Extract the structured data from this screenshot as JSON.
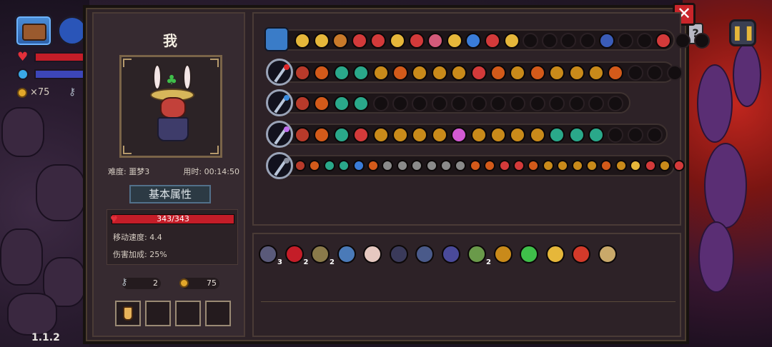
{
  "hud": {
    "coins": "×75",
    "version": "1.1.2",
    "pause_icon": "pause-icon",
    "help_icon": "?"
  },
  "panel": {
    "character_name": "我",
    "difficulty": "难度: 噩梦3",
    "time": "用时: 00:14:50",
    "stats_header": "基本属性",
    "hp": "343/343",
    "hp_fill": 1.0,
    "move_speed": "移动速度: 4.4",
    "damage_bonus": "伤害加成: 25%",
    "keys": "2",
    "coins": "75",
    "close_icon": "✕"
  },
  "colors": {
    "accent_red": "#c41d28",
    "mana_blue": "#3c46b8",
    "panel_bg": "#2d2227",
    "gold": "#e2a72a"
  },
  "weapon_rows": [
    {
      "main": "chest",
      "icons": [
        "#e6b73a",
        "#e6b73a",
        "#c97a2a",
        "#d33a3a",
        "#d33a3a",
        "#e6b73a",
        "#d33a3a",
        "#d35a7a",
        "#e6b73a",
        "#3a7cd8",
        "#d33a3a",
        "#e6b73a",
        "e",
        "e",
        "e",
        "e",
        "#3a5cb8",
        "e",
        "e",
        "#d33a3a",
        "e",
        "e"
      ]
    },
    {
      "main": "red",
      "icons": [
        "#b83a2a",
        "#d35a1a",
        "#2aa88a",
        "#2aa88a",
        "#c98a1a",
        "#d35a1a",
        "#c98a1a",
        "#c98a1a",
        "#c98a1a",
        "#d33a3a",
        "#d35a1a",
        "#c98a1a",
        "#d35a1a",
        "#c98a1a",
        "#c98a1a",
        "#c98a1a",
        "#d35a1a",
        "e",
        "e",
        "e"
      ]
    },
    {
      "main": "blue",
      "icons": [
        "#b83a2a",
        "#d35a1a",
        "#2aa88a",
        "#2aa88a",
        "e",
        "e",
        "e",
        "e",
        "e",
        "e",
        "e",
        "e",
        "e",
        "e",
        "e",
        "e",
        "e"
      ]
    },
    {
      "main": "purple",
      "icons": [
        "#b83a2a",
        "#d35a1a",
        "#2aa88a",
        "#d33a3a",
        "#c98a1a",
        "#c98a1a",
        "#c98a1a",
        "#c98a1a",
        "#d35ad3",
        "#c98a1a",
        "#c98a1a",
        "#c98a1a",
        "#c98a1a",
        "#2aa88a",
        "#2aa88a",
        "#2aa88a",
        "e",
        "e",
        "e"
      ]
    },
    {
      "main": "gray",
      "icons": [
        "#b83a2a",
        "#d35a1a",
        "#2aa88a",
        "#2aa88a",
        "#3a7cd8",
        "#d35a1a",
        "#8a8a8a",
        "#8a8a8a",
        "#8a8a8a",
        "#8a8a8a",
        "#8a8a8a",
        "#8a8a8a",
        "#d35a1a",
        "#d35a1a",
        "#d33a3a",
        "#d33a3a",
        "#d35a1a",
        "#c98a1a",
        "#c98a1a",
        "#c98a1a",
        "#c98a1a",
        "#d35a1a",
        "#c98a1a",
        "#e6b73a",
        "#d33a3a",
        "#c98a1a",
        "#d33a3a"
      ]
    }
  ],
  "inventory": [
    {
      "icon": "#5a5a7a",
      "count": "3"
    },
    {
      "icon": "#c41d28",
      "count": "2"
    },
    {
      "icon": "#8a7a4a",
      "count": "2"
    },
    {
      "icon": "#4a7ab8",
      "count": ""
    },
    {
      "icon": "#e6c8c0",
      "count": ""
    },
    {
      "icon": "#3a3a5a",
      "count": ""
    },
    {
      "icon": "#4a5a8a",
      "count": ""
    },
    {
      "icon": "#4a4a9a",
      "count": ""
    },
    {
      "icon": "#6a9a4a",
      "count": "2"
    },
    {
      "icon": "#c98a1a",
      "count": ""
    },
    {
      "icon": "#3fbf4a",
      "count": ""
    },
    {
      "icon": "#e6b73a",
      "count": ""
    },
    {
      "icon": "#d33a2a",
      "count": ""
    },
    {
      "icon": "#c9a96a",
      "count": ""
    }
  ]
}
